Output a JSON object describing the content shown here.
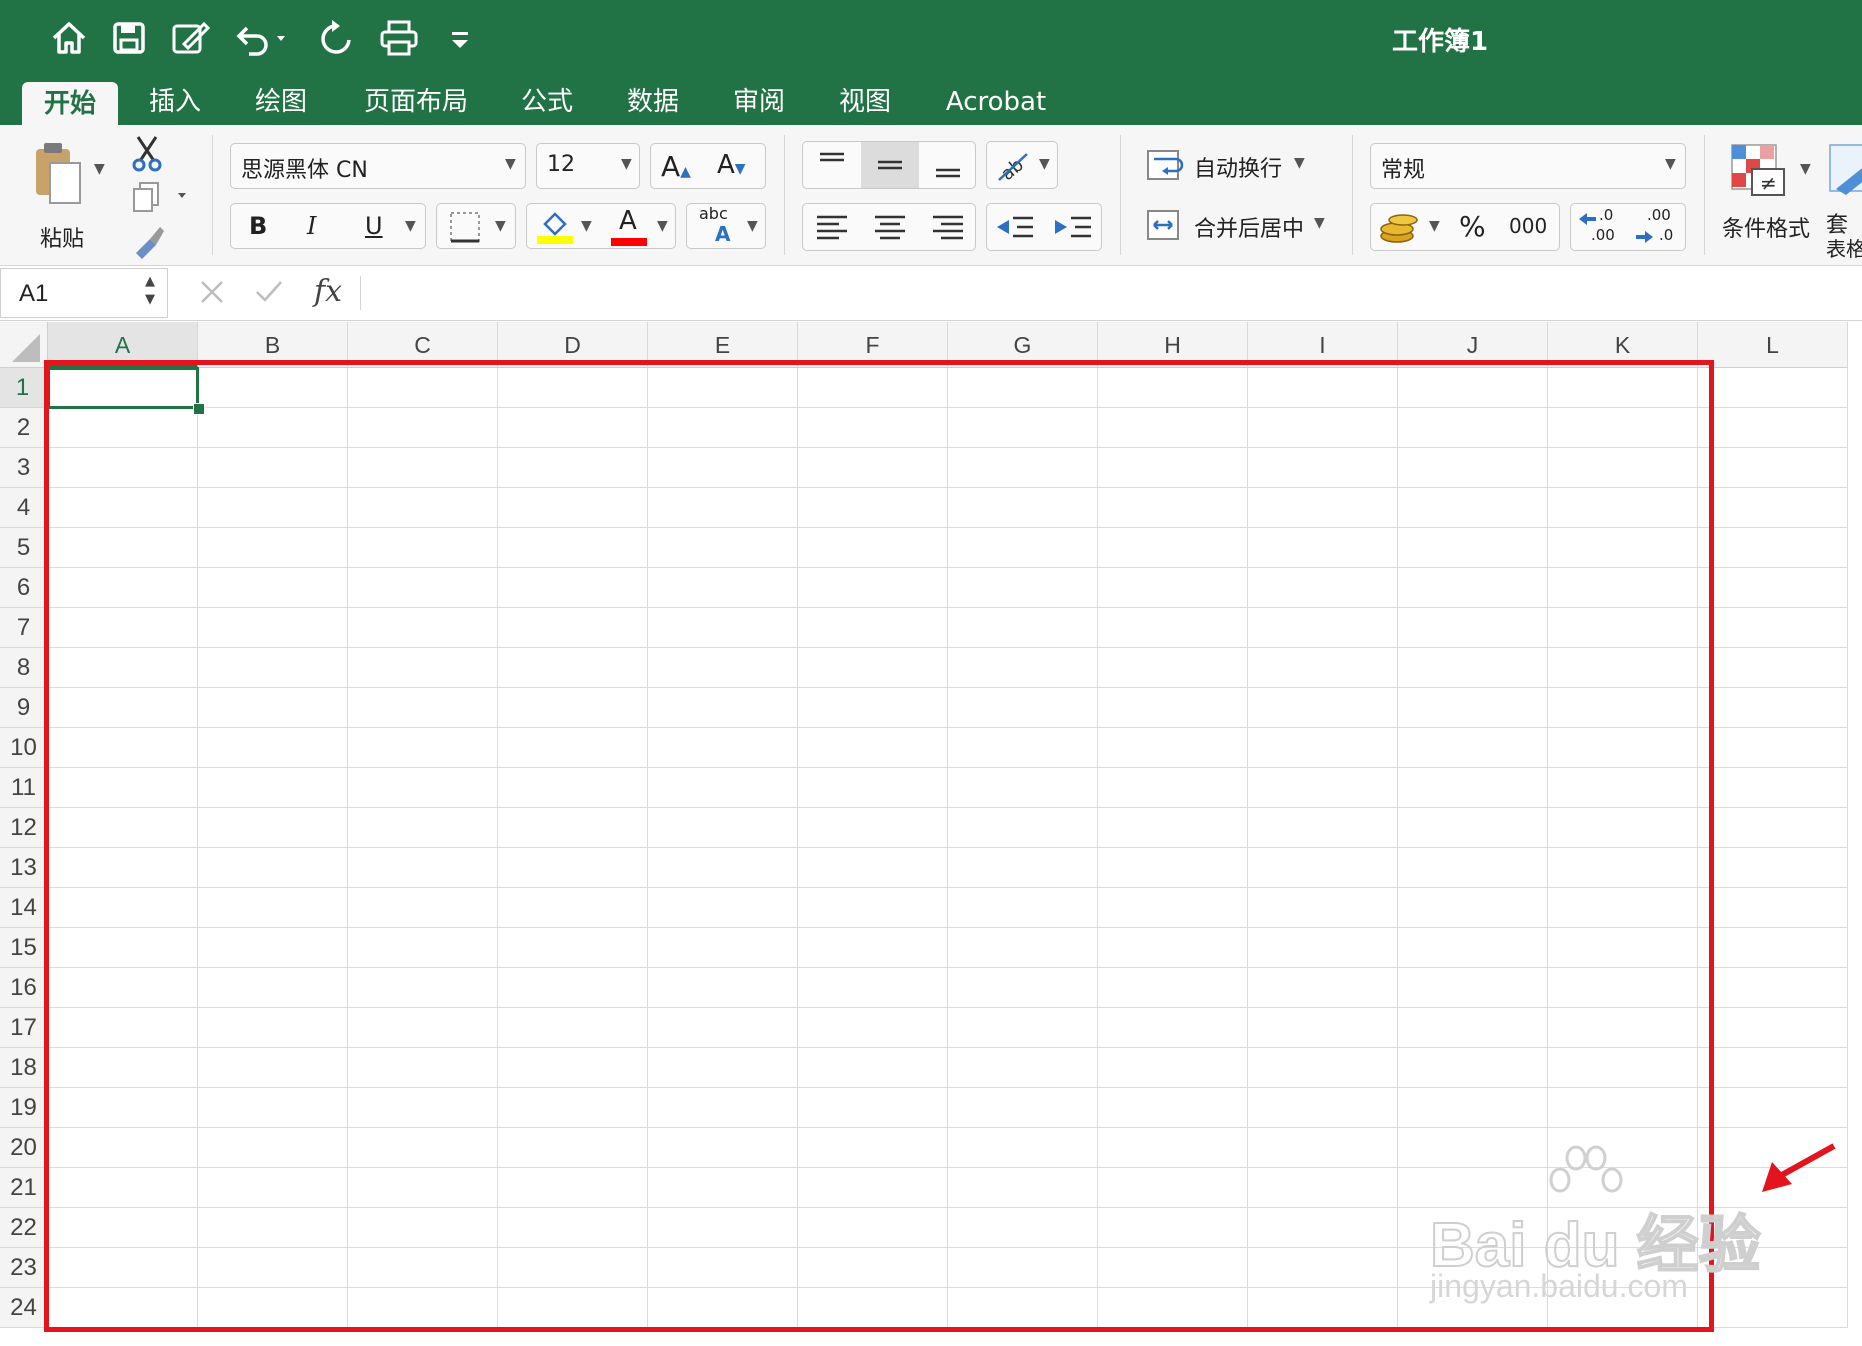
{
  "window": {
    "title": "工作簿1"
  },
  "quick_access": [
    "home-icon",
    "save-icon",
    "edit-icon",
    "undo-icon",
    "redo-icon",
    "print-icon",
    "customize-icon"
  ],
  "tabs": [
    "开始",
    "插入",
    "绘图",
    "页面布局",
    "公式",
    "数据",
    "审阅",
    "视图",
    "Acrobat"
  ],
  "active_tab": "开始",
  "clipboard": {
    "paste_label": "粘贴"
  },
  "font": {
    "name": "思源黑体 CN",
    "size": "12",
    "bold": "B",
    "italic": "I",
    "underline": "U",
    "grow": "A",
    "shrink": "A",
    "color_letter": "A",
    "phonetic_top": "abc",
    "phonetic_bottom": "A",
    "highlight_color": "#ffff00",
    "font_color": "#ff0000"
  },
  "alignment": {
    "wrap_text": "自动换行",
    "merge_center": "合并后居中"
  },
  "number": {
    "format": "常规",
    "percent": "%",
    "thousands": "000",
    "dec_inc_top": ".0",
    "dec_inc_bottom": ".00",
    "dec_dec_top": ".00",
    "dec_dec_bottom": ".0"
  },
  "styles": {
    "conditional_format": "条件格式",
    "format_table_top": "套",
    "format_table_bottom": "表格"
  },
  "formula_bar": {
    "name_box": "A1",
    "fx": "fx",
    "formula": ""
  },
  "sheet": {
    "columns": [
      "A",
      "B",
      "C",
      "D",
      "E",
      "F",
      "G",
      "H",
      "I",
      "J",
      "K",
      "L"
    ],
    "rows": [
      "1",
      "2",
      "3",
      "4",
      "5",
      "6",
      "7",
      "8",
      "9",
      "10",
      "11",
      "12",
      "13",
      "14",
      "15",
      "16",
      "17",
      "18",
      "19",
      "20",
      "21",
      "22",
      "23",
      "24"
    ],
    "selected_cell": "A1",
    "accent_color": "#217346",
    "highlight_box_color": "#e3141e"
  },
  "watermark": {
    "brand": "Bai du 经验",
    "url": "jingyan.baidu.com"
  }
}
